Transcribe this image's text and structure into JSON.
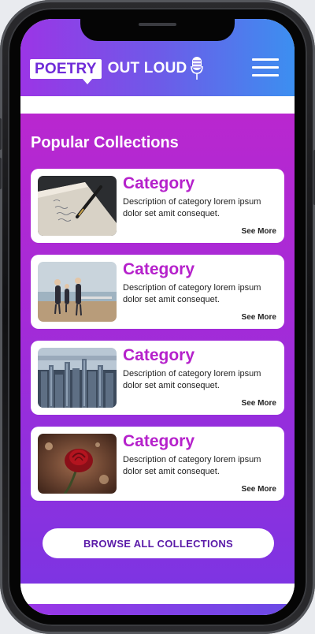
{
  "header": {
    "logo_word_boxed": "POETRY",
    "logo_word_rest": "OUT LOUD",
    "menu_icon": "hamburger-menu-icon",
    "mic_icon": "microphone-icon"
  },
  "main": {
    "section_title": "Popular Collections",
    "cards": [
      {
        "title": "Category",
        "description": "Description of category lorem ipsum dolor set amit consequet.",
        "link": "See More",
        "image": "pen-and-notebook"
      },
      {
        "title": "Category",
        "description": "Description of category lorem ipsum dolor set amit consequet.",
        "link": "See More",
        "image": "family-at-waterfront"
      },
      {
        "title": "Category",
        "description": "Description of category lorem ipsum dolor set amit consequet.",
        "link": "See More",
        "image": "city-skyline"
      },
      {
        "title": "Category",
        "description": "Description of category lorem ipsum dolor set amit consequet.",
        "link": "See More",
        "image": "red-rose"
      }
    ],
    "browse_button": "BROWSE ALL COLLECTIONS"
  },
  "colors": {
    "accent_purple": "#b521cb",
    "header_gradient_start": "#9b35e6",
    "header_gradient_end": "#3c8ff0",
    "button_text": "#5a1aa8"
  }
}
